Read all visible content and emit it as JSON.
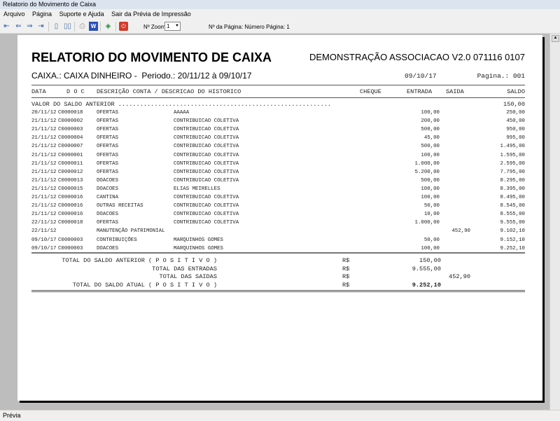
{
  "window": {
    "title": "Relatorio do Movimento de Caixa"
  },
  "menu": [
    "Arquivo",
    "Página",
    "Suporte e Ajuda",
    "Sair da Prévia de Impressão"
  ],
  "toolbar": {
    "zoom_label": "Nº Zoom",
    "zoom_value": "1",
    "page_info": "Nº da Página: Número Página: 1"
  },
  "status": "Prévia",
  "report": {
    "title": "RELATORIO DO MOVIMENTO DE CAIXA",
    "company": "DEMONSTRAÇÃO ASSOCIACAO V2.0 071116 0107",
    "subtitle": "CAIXA.: CAIXA DINHEIRO -  Periodo.: 20/11/12 à 09/10/17",
    "date": "09/10/17",
    "page": "Pagina.: 001",
    "headers": {
      "data": "DATA",
      "doc": "D O C",
      "desc": "DESCRIÇÃO CONTA / DESCRICAO DO HISTORICO",
      "cheque": "CHEQUE",
      "entrada": "ENTRADA",
      "saida": "SAIDA",
      "saldo": "SALDO"
    },
    "opening": {
      "label": "VALOR DO SALDO ANTERIOR ...........................................................",
      "saldo": "150,00"
    },
    "rows": [
      {
        "data": "20/11/12",
        "doc": "C0000018",
        "conta": "OFERTAS",
        "hist": "AAAAA",
        "entrada": "100,00",
        "saida": "",
        "saldo": "250,00"
      },
      {
        "data": "21/11/12",
        "doc": "C0000002",
        "conta": "OFERTAS",
        "hist": "CONTRIBUICAO COLETIVA",
        "entrada": "200,00",
        "saida": "",
        "saldo": "450,00"
      },
      {
        "data": "21/11/12",
        "doc": "C0000003",
        "conta": "OFERTAS",
        "hist": "CONTRIBUICAO COLETIVA",
        "entrada": "500,00",
        "saida": "",
        "saldo": "950,00"
      },
      {
        "data": "21/11/12",
        "doc": "C0000004",
        "conta": "OFERTAS",
        "hist": "CONTRIBUICAO COLETIVA",
        "entrada": "45,00",
        "saida": "",
        "saldo": "995,00"
      },
      {
        "data": "21/11/12",
        "doc": "C0000007",
        "conta": "OFERTAS",
        "hist": "CONTRIBUICAO COLETIVA",
        "entrada": "500,00",
        "saida": "",
        "saldo": "1.495,00"
      },
      {
        "data": "21/11/12",
        "doc": "C0000001",
        "conta": "OFERTAS",
        "hist": "CONTRIBUICAO COLETIVA",
        "entrada": "100,00",
        "saida": "",
        "saldo": "1.595,00"
      },
      {
        "data": "21/11/12",
        "doc": "C0000011",
        "conta": "OFERTAS",
        "hist": "CONTRIBUICAO COLETIVA",
        "entrada": "1.000,00",
        "saida": "",
        "saldo": "2.595,00"
      },
      {
        "data": "21/11/12",
        "doc": "C0000012",
        "conta": "OFERTAS",
        "hist": "CONTRIBUICAO COLETIVA",
        "entrada": "5.200,00",
        "saida": "",
        "saldo": "7.795,00"
      },
      {
        "data": "21/11/12",
        "doc": "C0000013",
        "conta": "DOACOES",
        "hist": "CONTRIBUICAO COLETIVA",
        "entrada": "500,00",
        "saida": "",
        "saldo": "8.295,00"
      },
      {
        "data": "21/11/12",
        "doc": "C0000015",
        "conta": "DOACOES",
        "hist": "ELIAS MEIRELLES",
        "entrada": "100,00",
        "saida": "",
        "saldo": "8.395,00"
      },
      {
        "data": "21/11/12",
        "doc": "C0000016",
        "conta": "CANTINA",
        "hist": "CONTRIBUICAO COLETIVA",
        "entrada": "100,00",
        "saida": "",
        "saldo": "8.495,00"
      },
      {
        "data": "21/11/12",
        "doc": "C0000016",
        "conta": "OUTRAS RECEITAS",
        "hist": "CONTRIBUICAO COLETIVA",
        "entrada": "50,00",
        "saida": "",
        "saldo": "8.545,00"
      },
      {
        "data": "21/11/12",
        "doc": "C0000016",
        "conta": "DOACOES",
        "hist": "CONTRIBUICAO COLETIVA",
        "entrada": "10,00",
        "saida": "",
        "saldo": "8.555,00"
      },
      {
        "data": "22/11/12",
        "doc": "C0000018",
        "conta": "OFERTAS",
        "hist": "CONTRIBUICAO COLETIVA",
        "entrada": "1.000,00",
        "saida": "",
        "saldo": "9.555,00"
      },
      {
        "data": "22/11/12",
        "doc": "",
        "conta": "MANUTENÇÃO PATRIMONIAL",
        "hist": "",
        "entrada": "",
        "saida": "452,90",
        "saldo": "9.102,10"
      },
      {
        "data": "09/10/17",
        "doc": "C0000003",
        "conta": "CONTRIBUIÇÕES",
        "hist": "MARQUINHOS GOMES",
        "entrada": "50,00",
        "saida": "",
        "saldo": "9.152,10"
      },
      {
        "data": "09/10/17",
        "doc": "C0000003",
        "conta": "DOACOES",
        "hist": "MARQUINHOS GOMES",
        "entrada": "100,00",
        "saida": "",
        "saldo": "9.252,10"
      }
    ],
    "totals": [
      {
        "label": "TOTAL DO SALDO ANTERIOR ( P O S I T I V O )",
        "cur": "R$",
        "entrada": "150,00",
        "saida": ""
      },
      {
        "label": "TOTAL DAS ENTRADAS",
        "cur": "R$",
        "entrada": "9.555,00",
        "saida": ""
      },
      {
        "label": "TOTAL DAS SAIDAS",
        "cur": "R$",
        "entrada": "",
        "saida": "452,90"
      },
      {
        "label": "TOTAL DO SALDO ATUAL ( P O S I T I V O )",
        "cur": "R$",
        "entrada": "9.252,10",
        "saida": ""
      }
    ]
  }
}
